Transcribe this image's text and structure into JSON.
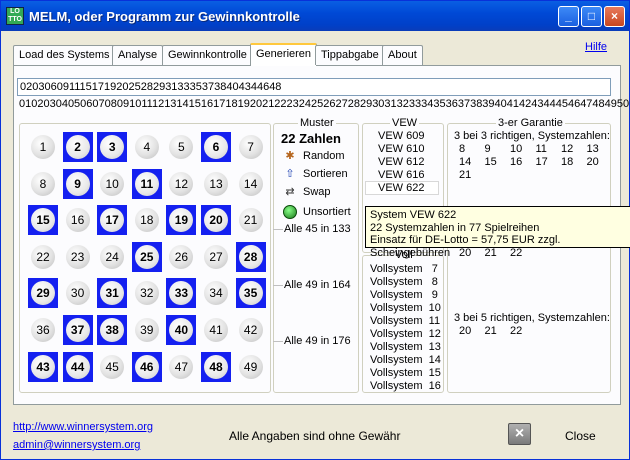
{
  "window": {
    "title": "MELM, oder Programm zur Gewinnkontrolle",
    "icon_text": "LO\nTTO"
  },
  "titlebar_buttons": {
    "minimize": "_",
    "maximize": "□",
    "close": "×"
  },
  "tabs": [
    {
      "label": "Load des Systems"
    },
    {
      "label": "Analyse"
    },
    {
      "label": "Gewinnkontrolle"
    },
    {
      "label": "Generieren",
      "active": true
    },
    {
      "label": "Tippabgabe"
    },
    {
      "label": "About"
    }
  ],
  "help_link": "Hilfe",
  "number_input": "0203060911151719202528293133353738404344648",
  "number_line": "0102030405060708091011121314151617181920212223242526272829303132333435363738394041424344454647484950",
  "grid": {
    "numbers": [
      1,
      2,
      3,
      4,
      5,
      6,
      7,
      8,
      9,
      10,
      11,
      12,
      13,
      14,
      15,
      16,
      17,
      18,
      19,
      20,
      21,
      22,
      23,
      24,
      25,
      26,
      27,
      28,
      29,
      30,
      31,
      32,
      33,
      34,
      35,
      36,
      37,
      38,
      39,
      40,
      41,
      42,
      43,
      44,
      45,
      46,
      47,
      48,
      49
    ],
    "selected": [
      2,
      3,
      6,
      9,
      11,
      15,
      17,
      19,
      20,
      25,
      28,
      29,
      31,
      33,
      35,
      37,
      38,
      40,
      43,
      44,
      46,
      48
    ],
    "highlight_color": "#1420f0"
  },
  "muster": {
    "label": "Muster",
    "count_label": "22 Zahlen",
    "buttons": [
      {
        "label": "Random",
        "icon": "dice-icon"
      },
      {
        "label": "Sortieren",
        "icon": "arrow-up-icon"
      },
      {
        "label": "Swap",
        "icon": "swap-icon"
      },
      {
        "label": "Unsortiert",
        "icon": "green-ball-icon"
      }
    ],
    "alle_labels": [
      "Alle 45 in 133",
      "Alle 49 in 164",
      "Alle 49 in 176"
    ]
  },
  "vew": {
    "label": "VEW",
    "items": [
      "VEW 609",
      "VEW 610",
      "VEW 612",
      "VEW 616",
      "VEW 622"
    ],
    "selected": "VEW 622"
  },
  "voll": {
    "label": "Voll",
    "items": [
      "Vollsystem   7",
      "Vollsystem   8",
      "Vollsystem   9",
      "Vollsystem  10",
      "Vollsystem  11",
      "Vollsystem  12",
      "Vollsystem  13",
      "Vollsystem  14",
      "Vollsystem  15",
      "Vollsystem  16"
    ]
  },
  "tooltip": {
    "line1": "System VEW 622",
    "line2": "22 Systemzahlen in 77 Spielreihen",
    "line3": "Einsatz für DE-Lotto = 57,75 EUR zzgl. Scheingebühren"
  },
  "garantie": {
    "label": "3-er Garantie",
    "head1": "3 bei 3 richtigen, Systemzahlen:",
    "rows1": [
      [
        "8",
        "9",
        "10",
        "11",
        "12",
        "13"
      ],
      [
        "14",
        "15",
        "16",
        "17",
        "18",
        "20"
      ],
      [
        "21"
      ]
    ],
    "partial_row": [
      "20",
      "21",
      "22"
    ],
    "head2": "3 bei 5 richtigen, Systemzahlen:",
    "rows2": [
      [
        "20",
        "21",
        "22"
      ]
    ]
  },
  "footer": {
    "link1": "http://www.winnersystem.org",
    "link2": "admin@winnersystem.org",
    "disclaimer": "Alle Angaben sind ohne Gewähr",
    "close_icon": "×",
    "close_label": "Close"
  }
}
